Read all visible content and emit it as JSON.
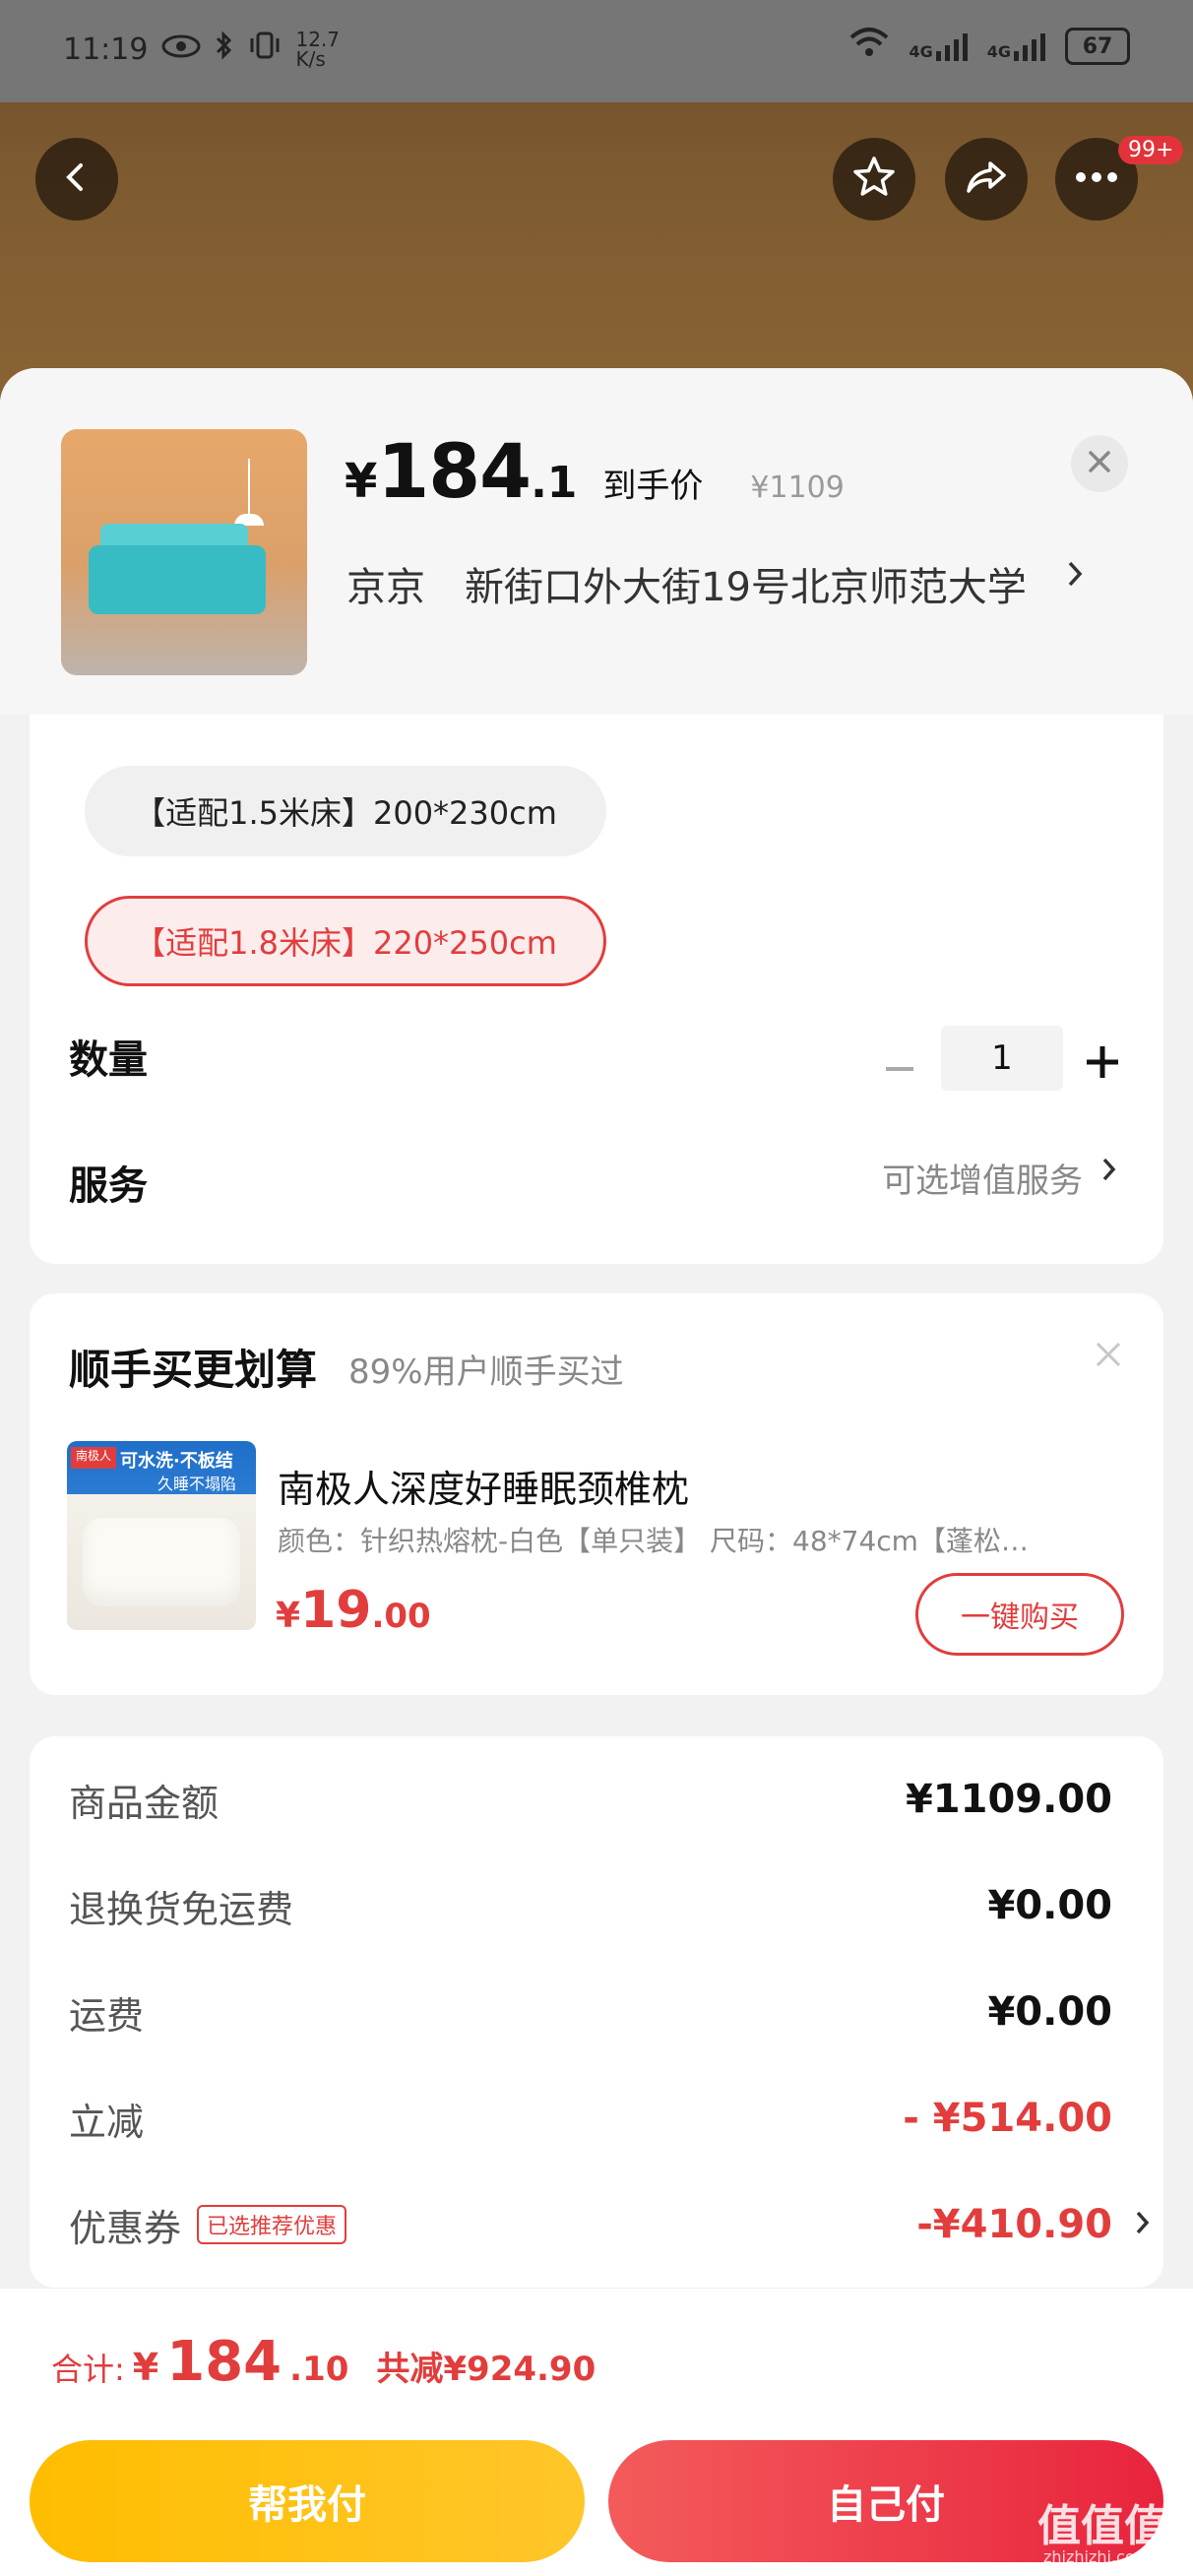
{
  "status_bar": {
    "time": "11:19",
    "net_speed": "12.7 K/s",
    "battery": "67",
    "signal_1": "4G",
    "signal_2": "4G"
  },
  "top_bar": {
    "badge": "99+",
    "icons": [
      "back-icon",
      "star-icon",
      "share-icon",
      "more-icon"
    ]
  },
  "product": {
    "price_yen": "¥",
    "price_int": "184",
    "price_dec": ".1",
    "price_label": "到手价",
    "original_price": "¥1109",
    "address_prefix": "京京",
    "address": "新街口外大街19号北京师范大学"
  },
  "options": {
    "size_a": "【适配1.5米床】200*230cm",
    "size_b": "【适配1.8米床】220*250cm",
    "selected": "size_b"
  },
  "quantity": {
    "label": "数量",
    "value": "1"
  },
  "service": {
    "label": "服务",
    "hint": "可选增值服务"
  },
  "upsell": {
    "title": "顺手买更划算",
    "subtitle": "89%用户顺手买过",
    "product_name": "南极人深度好睡眠颈椎枕",
    "spec": "颜色：针织热熔枕-白色【单只装】    尺码：48*74cm【蓬松…",
    "price_yen": "¥",
    "price_int": "19",
    "price_dec": ".00",
    "buy_label": "一键购买",
    "img_brand": "南极人",
    "img_text1": "可水洗·不板结",
    "img_text2": "久睡不塌陷"
  },
  "fees": [
    {
      "label": "商品金额",
      "value": "¥1109.00",
      "red": false
    },
    {
      "label": "退换货免运费",
      "value": "¥0.00",
      "red": false
    },
    {
      "label": "运费",
      "value": "¥0.00",
      "red": false
    },
    {
      "label": "立减",
      "value": "- ¥514.00",
      "red": true
    },
    {
      "label": "优惠券",
      "tag": "已选推荐优惠",
      "value": "-¥410.90",
      "red": true
    }
  ],
  "footer": {
    "total_label": "合计:",
    "total_yen": "¥",
    "total_int": "184",
    "total_dec": ".10",
    "saved": "共减¥924.90",
    "btn_help": "帮我付",
    "btn_self": "自己付"
  },
  "watermark": {
    "main": "值值值",
    "sub": "zhizhizhi.com"
  }
}
